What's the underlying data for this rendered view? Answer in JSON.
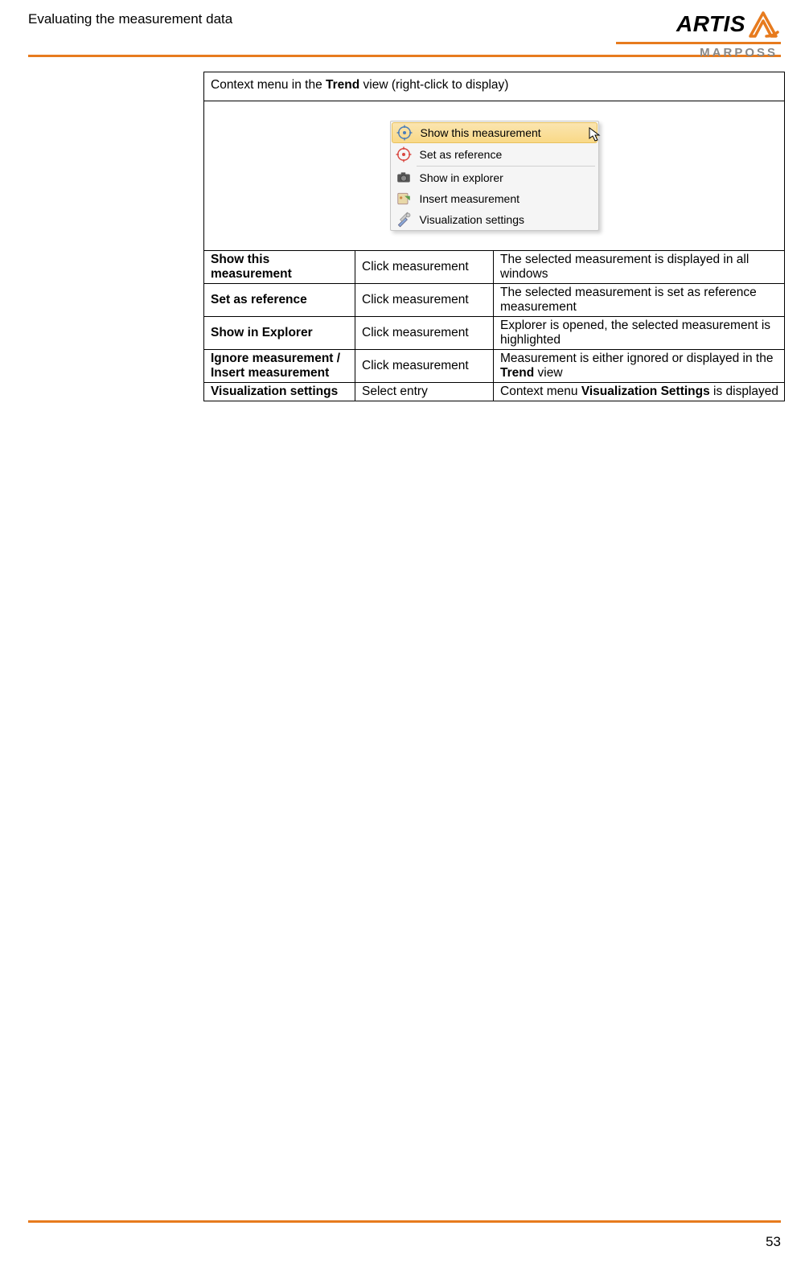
{
  "header": {
    "title": "Evaluating the measurement data",
    "logo_main": "ARTIS",
    "logo_sub": "MARPOSS"
  },
  "table": {
    "title_prefix": "Context menu in the ",
    "title_bold": "Trend",
    "title_suffix": " view (right-click to display)",
    "context_menu": {
      "items": [
        {
          "label": "Show this measurement",
          "highlighted": true
        },
        {
          "label": "Set as reference"
        },
        {
          "label": "Show in explorer"
        },
        {
          "label": "Insert measurement"
        },
        {
          "label": "Visualization settings"
        }
      ]
    },
    "rows": [
      {
        "name": "Show this measurement",
        "action": "Click measurement",
        "desc": "The selected measurement is displayed in all windows"
      },
      {
        "name": "Set as reference",
        "action": "Click measurement",
        "desc": "The selected measurement is set as reference measurement"
      },
      {
        "name": "Show in Explorer",
        "action": "Click measurement",
        "desc": "Explorer is opened, the selected measurement is highlighted"
      },
      {
        "name": "Ignore measurement / Insert measurement",
        "action": "Click measurement",
        "desc_pre": "Measurement is either ignored or displayed in the ",
        "desc_bold": "Trend",
        "desc_post": " view"
      },
      {
        "name": "Visualization settings",
        "action": "Select entry",
        "desc_pre": "Context menu ",
        "desc_bold": "Visualization Settings",
        "desc_post": " is displayed"
      }
    ]
  },
  "page_number": "53"
}
